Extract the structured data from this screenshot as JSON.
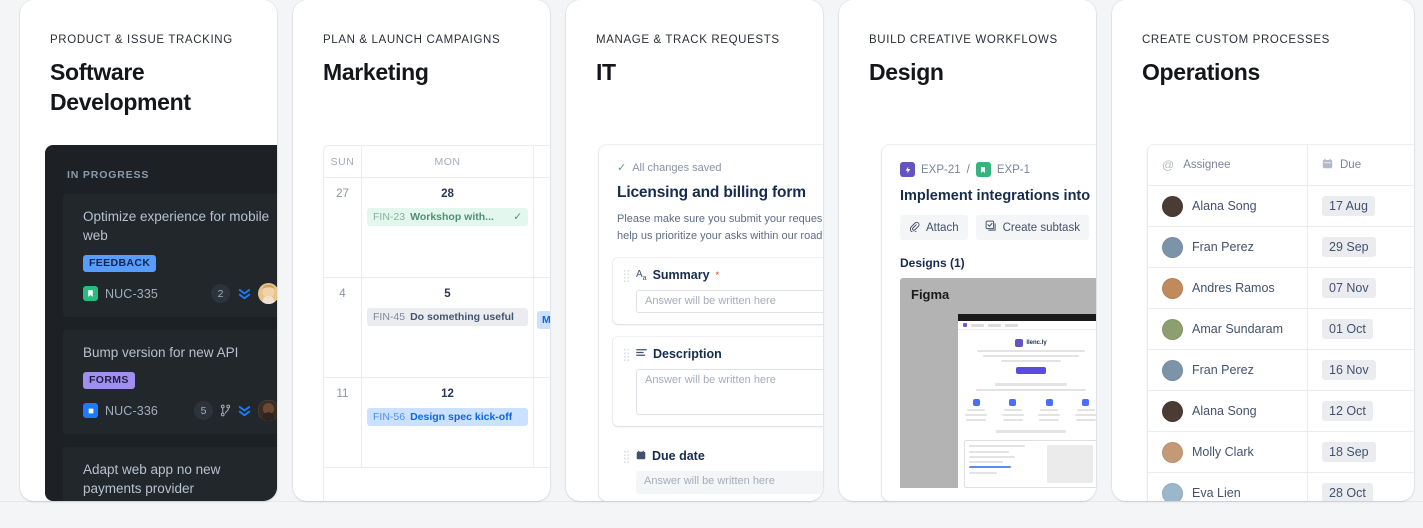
{
  "cards": [
    {
      "eyebrow": "PRODUCT & ISSUE TRACKING",
      "title_line1": "Software",
      "title_line2": "Development",
      "board": {
        "column": "IN PROGRESS",
        "items": [
          {
            "title": "Optimize experience for mobile web",
            "label": "FEEDBACK",
            "label_color": "#579dff",
            "key": "NUC-335",
            "key_icon": "story-icon",
            "key_icon_color": "#2abb7f",
            "count": "2",
            "priority_icon": "priority-highest-icon",
            "avatar": "avatar-blonde"
          },
          {
            "title": "Bump version for new API",
            "label": "FORMS",
            "label_color": "#9f8fef",
            "key": "NUC-336",
            "key_icon": "task-icon",
            "key_icon_color": "#1d7afc",
            "count": "5",
            "branch_icon": "branch-icon",
            "priority_icon": "priority-highest-icon",
            "avatar": "avatar-dark"
          },
          {
            "title": "Adapt web app no new payments provider",
            "label": "",
            "key": "",
            "count": ""
          }
        ]
      }
    },
    {
      "eyebrow": "PLAN & LAUNCH CAMPAIGNS",
      "title_line1": "Marketing",
      "title_line2": "",
      "calendar": {
        "headers": [
          "SUN",
          "MON",
          ""
        ],
        "weeks": [
          {
            "sun": "27",
            "mon": "28",
            "event": {
              "code": "FIN-23",
              "name": "Workshop with...",
              "style": "green",
              "done": "✓"
            },
            "right_event": ""
          },
          {
            "sun": "4",
            "mon": "5",
            "event": {
              "code": "FIN-45",
              "name": "Do something useful",
              "style": "gray",
              "done": ""
            },
            "right_event": "M"
          },
          {
            "sun": "11",
            "mon": "12",
            "event": {
              "code": "FIN-56",
              "name": "Design spec kick-off",
              "style": "blue",
              "done": ""
            },
            "right_event": ""
          }
        ]
      }
    },
    {
      "eyebrow": "MANAGE & TRACK REQUESTS",
      "title_line1": "IT",
      "title_line2": "",
      "form": {
        "saved_status": "All changes saved",
        "title": "Licensing and billing form",
        "description_line1": "Please make sure you submit your reques",
        "description_line2": "help us prioritize your asks within our road",
        "fields": [
          {
            "icon": "text-format-icon",
            "label": "Summary",
            "required": "*",
            "placeholder": "Answer will be written here",
            "style": "input"
          },
          {
            "icon": "paragraph-icon",
            "label": "Description",
            "required": "",
            "placeholder": "Answer will be written here",
            "style": "textarea"
          },
          {
            "icon": "calendar-icon",
            "label": "Due date",
            "required": "",
            "placeholder": "Answer will be written here",
            "style": "plain"
          }
        ]
      }
    },
    {
      "eyebrow": "BUILD CREATIVE WORKFLOWS",
      "title_line1": "Design",
      "title_line2": "",
      "issue": {
        "breadcrumb_parent": "EXP-21",
        "breadcrumb_parent_icon": "epic-icon",
        "breadcrumb_separator": "/",
        "breadcrumb_child": "EXP-1",
        "breadcrumb_child_icon": "story-icon",
        "title": "Implement integrations into",
        "buttons": [
          {
            "label": "Attach",
            "icon": "paperclip-icon"
          },
          {
            "label": "Create subtask",
            "icon": "subtask-icon"
          }
        ],
        "designs_label": "Designs (1)",
        "figma_label": "Figma"
      }
    },
    {
      "eyebrow": "CREATE CUSTOM PROCESSES",
      "title_line1": "Operations",
      "title_line2": "",
      "table": {
        "col_assignee": "Assignee",
        "col_assignee_icon": "mention-icon",
        "col_due": "Due",
        "col_due_icon": "calendar-icon",
        "rows": [
          {
            "name": "Alana Song",
            "due": "17 Aug",
            "avatar": "#4a3b33"
          },
          {
            "name": "Fran Perez",
            "due": "29 Sep",
            "avatar": "#7d94a8"
          },
          {
            "name": "Andres Ramos",
            "due": "07 Nov",
            "avatar": "#c08a5a"
          },
          {
            "name": "Amar Sundaram",
            "due": "01 Oct",
            "avatar": "#8d9f6e"
          },
          {
            "name": "Fran Perez",
            "due": "16 Nov",
            "avatar": "#7d94a8"
          },
          {
            "name": "Alana Song",
            "due": "12 Oct",
            "avatar": "#4a3b33"
          },
          {
            "name": "Molly Clark",
            "due": "18 Sep",
            "avatar": "#c49a76"
          },
          {
            "name": "Eva Lien",
            "due": "28 Oct",
            "avatar": "#9bb7cc"
          }
        ]
      }
    }
  ],
  "colors": {
    "page_background": "#f4f5f7",
    "card_background": "#ffffff",
    "board_background": "#1d2125",
    "accent_blue": "#0c66e4"
  }
}
